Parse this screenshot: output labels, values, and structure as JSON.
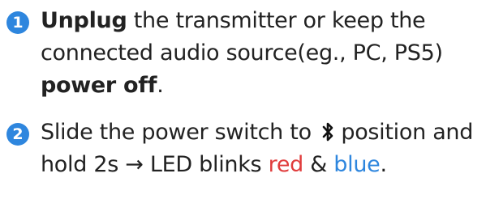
{
  "colors": {
    "badge": "#2e86de",
    "red": "#e03c3c",
    "blue": "#2e86de"
  },
  "steps": [
    {
      "number": "1",
      "parts": {
        "p1_bold": "Unplug",
        "p2": " the transmitter or keep the connected audio source(eg., PC, PS5) ",
        "p3_bold": "power off",
        "p4": "."
      }
    },
    {
      "number": "2",
      "icon": "bluetooth-icon",
      "parts": {
        "p1": "Slide the power switch to ",
        "p2": " position and hold 2s → LED blinks ",
        "red_word": "red",
        "amp": " & ",
        "blue_word": "blue",
        "period": "."
      }
    }
  ]
}
